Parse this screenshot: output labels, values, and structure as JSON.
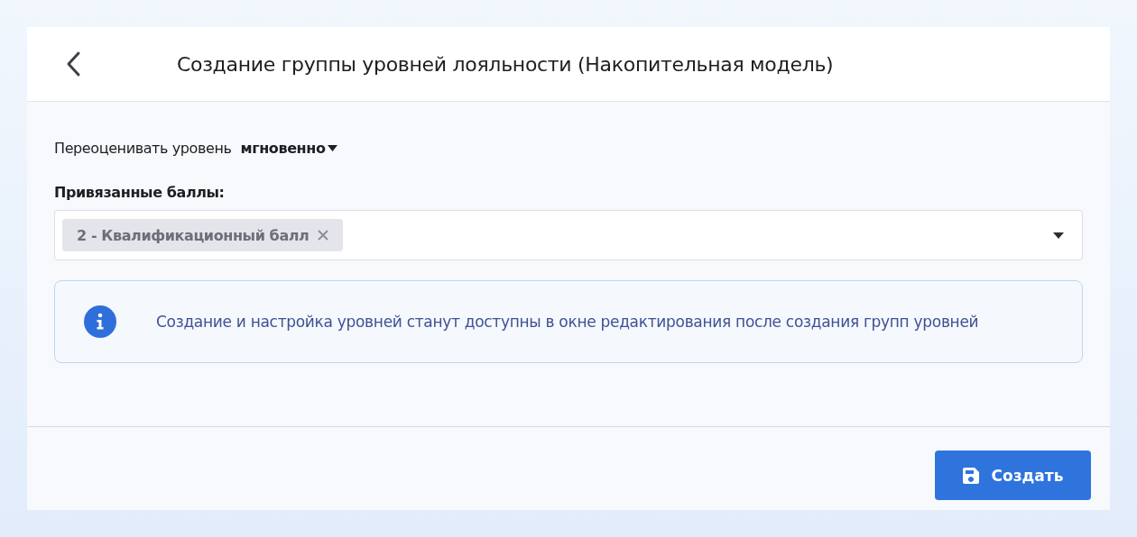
{
  "dialog": {
    "title": "Создание группы уровней лояльности (Накопительная модель)"
  },
  "reevaluate": {
    "label": "Переоценивать уровень",
    "value": "мгновенно"
  },
  "linked_points": {
    "label": "Привязанные баллы:",
    "tags": [
      {
        "label": "2 - Квалификационный балл"
      }
    ]
  },
  "info": {
    "text": "Создание и настройка уровней станут доступны в окне редактирования после создания групп уровней"
  },
  "buttons": [
    {
      "label": "Создать",
      "kind": "save"
    }
  ]
}
